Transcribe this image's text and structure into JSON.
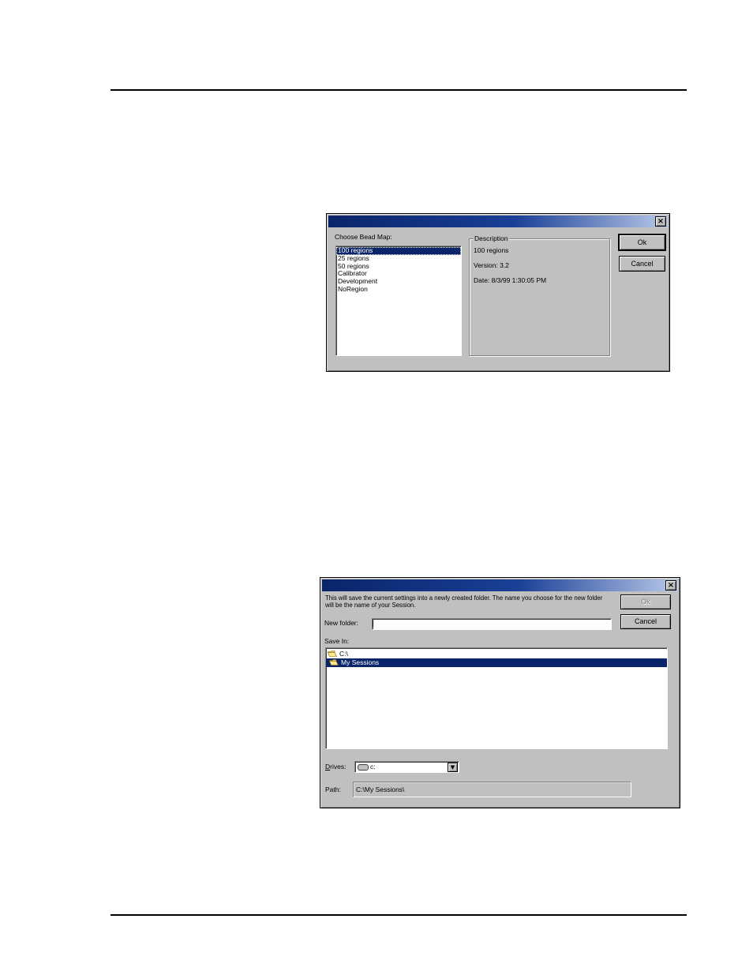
{
  "bead_map_dialog": {
    "title": "",
    "choose_label": "Choose Bead Map:",
    "bead_maps": [
      {
        "label": "100 regions",
        "selected": true
      },
      {
        "label": "25 regions",
        "selected": false
      },
      {
        "label": "50 regions",
        "selected": false
      },
      {
        "label": "Calibrator",
        "selected": false
      },
      {
        "label": "Development",
        "selected": false
      },
      {
        "label": "NoRegion",
        "selected": false
      }
    ],
    "description": {
      "legend": "Description",
      "name": "100 regions",
      "version": "Version: 3.2",
      "date": "Date: 8/3/99 1:30:05 PM"
    },
    "ok_label": "Ok",
    "cancel_label": "Cancel"
  },
  "save_session_dialog": {
    "title": "",
    "message_line1": "This will save the current settings into a newly created folder.  The name you choose for the new folder",
    "message_line2": "will be the name of your Session.",
    "new_folder_label": "New folder:",
    "new_folder_value": "",
    "save_in_label": "Save In:",
    "folders": [
      {
        "label": "C:\\",
        "selected": false,
        "icon": "open-folder-icon"
      },
      {
        "label": "My Sessions",
        "selected": true,
        "icon": "open-folder-icon"
      }
    ],
    "drives_label": "Drives:",
    "drive_value": "c:",
    "path_label": "Path:",
    "path_value": "C:\\My Sessions\\",
    "ok_label": "Ok",
    "cancel_label": "Cancel"
  },
  "colors": {
    "dialog_face": "#c0c0c0",
    "titlebar": "#0a246a",
    "selection": "#0a246a"
  }
}
